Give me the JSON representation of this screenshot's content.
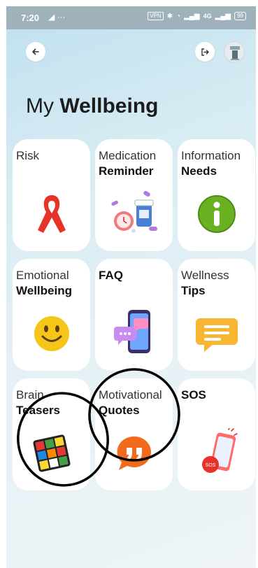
{
  "status_bar": {
    "time": "7:20",
    "left_icons": "◢ ···",
    "vpn": "VPN",
    "network": "4G",
    "battery": "99"
  },
  "header": {
    "back_icon": "arrow-left-icon",
    "logout_icon": "logout-icon",
    "avatar_icon": "profile-avatar"
  },
  "title": {
    "light": "My",
    "bold": "Wellbeing"
  },
  "tiles": [
    {
      "line1": "Risk",
      "line2": "",
      "icon": "red-ribbon-icon"
    },
    {
      "line1": "Medication",
      "line2": "Reminder",
      "icon": "pills-clock-icon"
    },
    {
      "line1": "Information",
      "line2": "Needs",
      "icon": "info-icon"
    },
    {
      "line1": "Emotional",
      "line2": "Wellbeing",
      "icon": "smiley-icon"
    },
    {
      "line1": "",
      "line2": "FAQ",
      "icon": "phone-chat-icon"
    },
    {
      "line1": "Wellness",
      "line2": "Tips",
      "icon": "chat-bubble-icon"
    },
    {
      "line1": "Brain",
      "line2": "Teasers",
      "icon": "rubiks-cube-icon"
    },
    {
      "line1": "Motivational",
      "line2": "Quotes",
      "icon": "quote-icon"
    },
    {
      "line1": "",
      "line2": "SOS",
      "icon": "sos-phone-icon"
    }
  ],
  "colors": {
    "status_bar": "#9fb2bc",
    "background": "#d8ecf4",
    "tile": "#ffffff",
    "ribbon": "#e5332a",
    "info_green": "#6ab023",
    "smiley": "#f5c518",
    "quote_orange": "#f26a1b",
    "annotation": "#000000"
  }
}
